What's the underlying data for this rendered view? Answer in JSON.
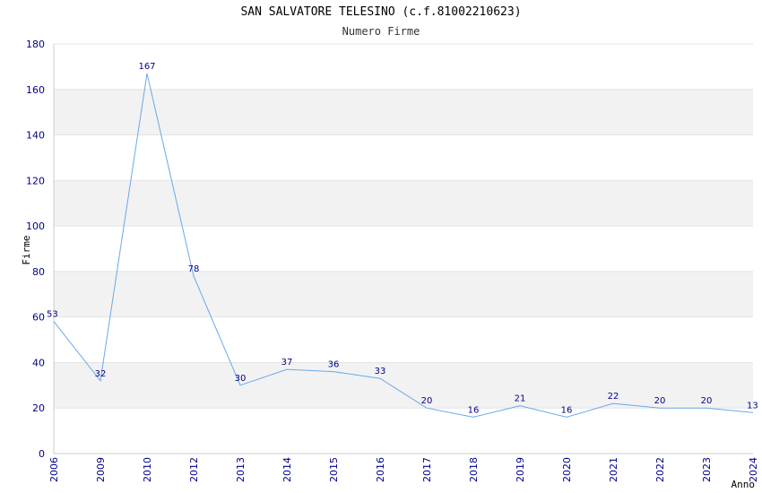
{
  "chart_data": {
    "type": "line",
    "title": "SAN SALVATORE TELESINO (c.f.81002210623)",
    "subtitle": "Numero Firme",
    "xlabel": "Anno",
    "ylabel": "Firme",
    "categories": [
      "2006",
      "2009",
      "2010",
      "2012",
      "2013",
      "2014",
      "2015",
      "2016",
      "2017",
      "2018",
      "2019",
      "2020",
      "2021",
      "2022",
      "2023",
      "2024"
    ],
    "series": [
      {
        "values": [
          58,
          32,
          167,
          78,
          30,
          37,
          36,
          33,
          20,
          16,
          21,
          16,
          22,
          20,
          20,
          18
        ],
        "labels": [
          "53",
          "32",
          "167",
          "78",
          "30",
          "37",
          "36",
          "33",
          "20",
          "16",
          "21",
          "16",
          "22",
          "20",
          "20",
          "13"
        ]
      }
    ],
    "ylim": [
      0,
      180
    ],
    "yticks": [
      0,
      20,
      40,
      60,
      80,
      100,
      120,
      140,
      160,
      180
    ],
    "grid": true,
    "line_color": "#6aa8e8",
    "band_color": "#f2f2f2",
    "tick_color": "#00008b"
  }
}
